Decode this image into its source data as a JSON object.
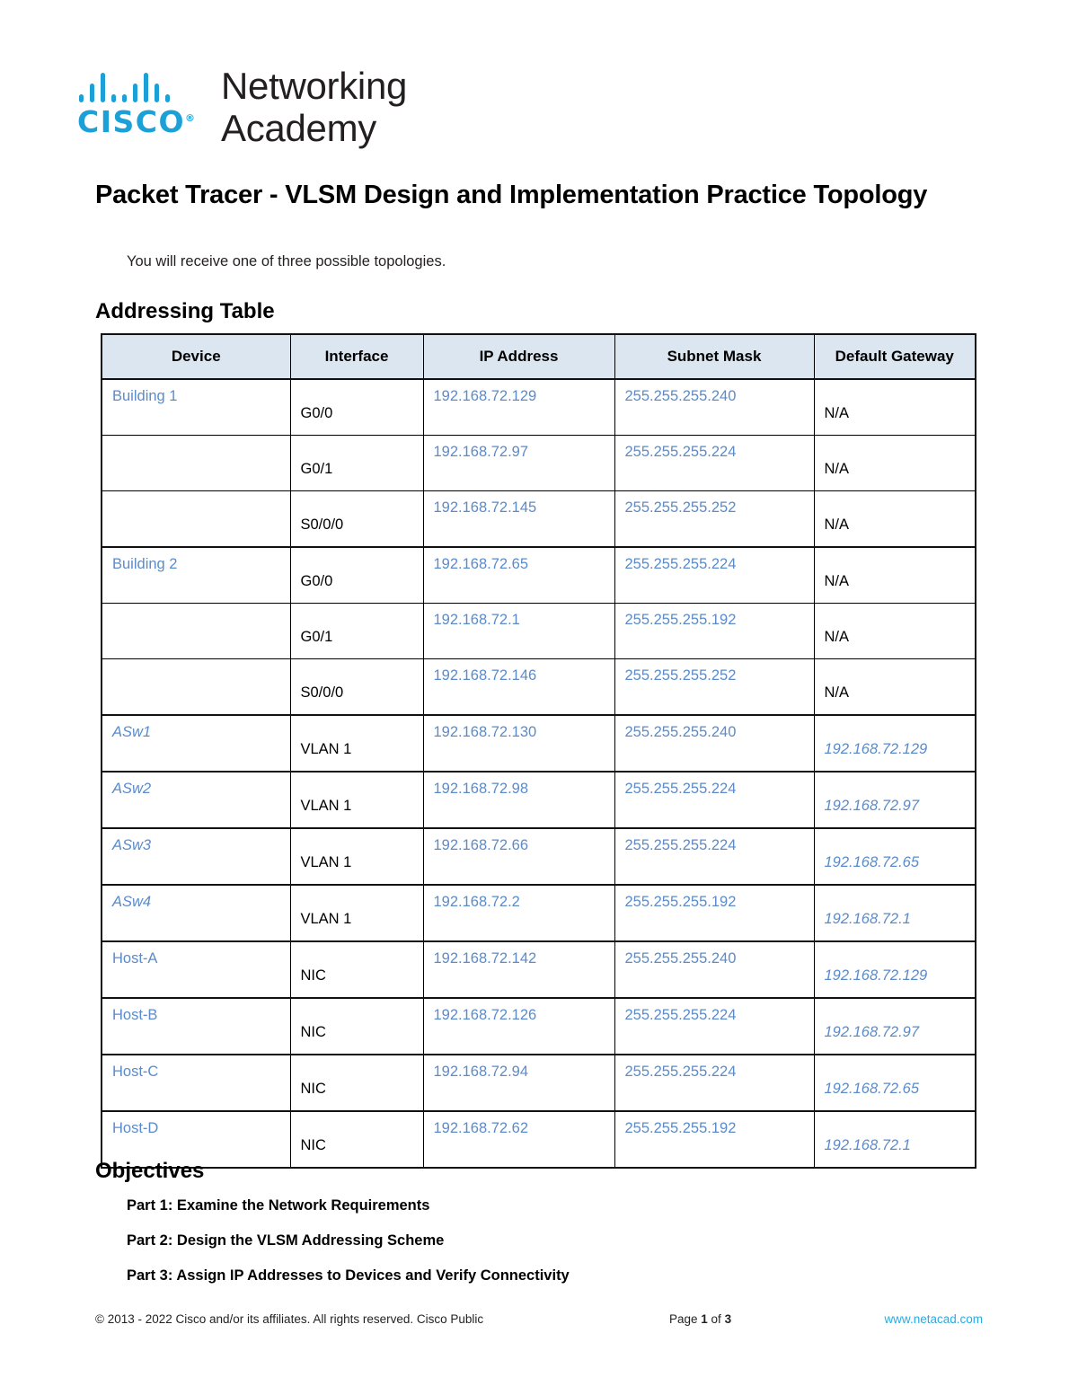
{
  "logo": {
    "brand": "CISCO",
    "line1": "Networking",
    "line2": "Academy",
    "brand_color": "#1BA0D7"
  },
  "document": {
    "title": "Packet Tracer - VLSM Design and Implementation Practice Topology",
    "subtitle": "You will receive one of three possible topologies."
  },
  "addressing": {
    "heading": "Addressing Table",
    "columns": [
      "Device",
      "Interface",
      "IP Address",
      "Subnet Mask",
      "Default Gateway"
    ],
    "value_color": "#5B8BC9",
    "header_fill": "#DCE6F1",
    "rows": [
      {
        "device": "Building 1",
        "device_style": "blue",
        "group_start": true,
        "interface": "G0/0",
        "ip": "192.168.72.129",
        "mask": "255.255.255.240",
        "gateway": "N/A",
        "gateway_style": "plain"
      },
      {
        "device": "",
        "device_style": "blue",
        "group_start": false,
        "interface": "G0/1",
        "ip": "192.168.72.97",
        "mask": "255.255.255.224",
        "gateway": "N/A",
        "gateway_style": "plain"
      },
      {
        "device": "",
        "device_style": "blue",
        "group_start": false,
        "interface": "S0/0/0",
        "ip": "192.168.72.145",
        "mask": "255.255.255.252",
        "gateway": "N/A",
        "gateway_style": "plain"
      },
      {
        "device": "Building 2",
        "device_style": "blue",
        "group_start": true,
        "interface": "G0/0",
        "ip": "192.168.72.65",
        "mask": "255.255.255.224",
        "gateway": "N/A",
        "gateway_style": "plain"
      },
      {
        "device": "",
        "device_style": "blue",
        "group_start": false,
        "interface": "G0/1",
        "ip": "192.168.72.1",
        "mask": "255.255.255.192",
        "gateway": "N/A",
        "gateway_style": "plain"
      },
      {
        "device": "",
        "device_style": "blue",
        "group_start": false,
        "interface": "S0/0/0",
        "ip": "192.168.72.146",
        "mask": "255.255.255.252",
        "gateway": "N/A",
        "gateway_style": "plain"
      },
      {
        "device": "ASw1",
        "device_style": "blue-i",
        "group_start": true,
        "interface": "VLAN 1",
        "ip": "192.168.72.130",
        "mask": "255.255.255.240",
        "gateway": "192.168.72.129",
        "gateway_style": "blue-i"
      },
      {
        "device": "ASw2",
        "device_style": "blue-i",
        "group_start": true,
        "interface": "VLAN 1",
        "ip": "192.168.72.98",
        "mask": "255.255.255.224",
        "gateway": "192.168.72.97",
        "gateway_style": "blue-i"
      },
      {
        "device": "ASw3",
        "device_style": "blue-i",
        "group_start": true,
        "interface": "VLAN 1",
        "ip": "192.168.72.66",
        "mask": "255.255.255.224",
        "gateway": "192.168.72.65",
        "gateway_style": "blue-i"
      },
      {
        "device": "ASw4",
        "device_style": "blue-i",
        "group_start": true,
        "interface": "VLAN 1",
        "ip": "192.168.72.2",
        "mask": "255.255.255.192",
        "gateway": "192.168.72.1",
        "gateway_style": "blue-i"
      },
      {
        "device": "Host-A",
        "device_style": "blue",
        "group_start": true,
        "interface": "NIC",
        "ip": "192.168.72.142",
        "mask": "255.255.255.240",
        "gateway": "192.168.72.129",
        "gateway_style": "blue-i"
      },
      {
        "device": "Host-B",
        "device_style": "blue",
        "group_start": true,
        "interface": "NIC",
        "ip": "192.168.72.126",
        "mask": "255.255.255.224",
        "gateway": "192.168.72.97",
        "gateway_style": "blue-i"
      },
      {
        "device": "Host-C",
        "device_style": "blue",
        "group_start": true,
        "interface": "NIC",
        "ip": "192.168.72.94",
        "mask": "255.255.255.224",
        "gateway": "192.168.72.65",
        "gateway_style": "blue-i"
      },
      {
        "device": "Host-D",
        "device_style": "blue",
        "group_start": true,
        "interface": "NIC",
        "ip": "192.168.72.62",
        "mask": "255.255.255.192",
        "gateway": "192.168.72.1",
        "gateway_style": "blue-i"
      }
    ]
  },
  "objectives": {
    "heading": "Objectives",
    "items": [
      "Part 1: Examine the Network Requirements",
      "Part 2: Design the VLSM Addressing Scheme",
      "Part 3: Assign IP Addresses to Devices and Verify Connectivity"
    ]
  },
  "footer": {
    "copyright": "© 2013 - 2022 Cisco and/or its affiliates. All rights reserved. Cisco Public",
    "page_prefix": "Page ",
    "page_number": "1",
    "page_middle": " of ",
    "page_total": "3",
    "url": "www.netacad.com",
    "url_color": "#29ABE2"
  }
}
